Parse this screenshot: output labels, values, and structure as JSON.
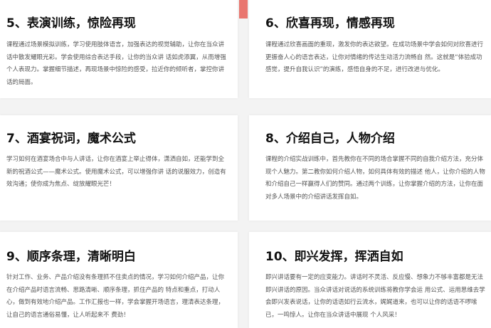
{
  "cards": [
    {
      "title": "5、表演训练，惊险再现",
      "body": "课程通过场景模拟训练，学习使用肢体语言，加强表达的视觉辅助，让你在当众讲话中散发耀眼光彩。学会使用综合表达手段，让你的当众讲 话如虎添翼，从而增强个人表现力。掌握细节描述，再现场景中惊险的感受，拉近你的倾听者，掌控你讲话的局面。"
    },
    {
      "title": "6、欣喜再现，情感再现",
      "body": "课程通过欣喜画面的重现，激发你的表达欲望。在成功场景中学会如何对欣喜进行更振奋人心的语言表达，让你对情绪的传达生动活力流畅自 然。这就是“体验成功感觉，提升自我认识”的演练，感悟自身的不足，进行改进与优化。"
    },
    {
      "title": "7、酒宴祝词，魔术公式",
      "body": "学习如何在酒宴场合中与人讲话，让你在酒宴上举止得体，潇洒自如，还能学到全新的祝酒公式——魔术公式。使用魔术公式，可以增强你讲 话的说服效力，创造有效沟通；使你成为焦点、绽放耀眼光芒！"
    },
    {
      "title": "8、介绍自己，人物介绍",
      "body": "课程的介绍实战训练中，首先教你在不同的场合掌握不同的自我介绍方法，充分体现个人魅力。第二教你如何介绍人物，如何具体有效的描述 他人，让你介绍的人物和介绍自己一样赢得人们的赞同。通过两个训练，让你掌握介绍的方法，让你在面对多人场景中的介绍讲话发挥自如。"
    },
    {
      "title": "9、顺序条理，清晰明白",
      "body": "针对工作、业务、产品介绍没有条理抓不住卖点的情况，学习如何介绍产品，让你在介绍产品时语言流畅、思路清晰、顺序条理，抓住产品的 特点和重点，打动人心，做到有效地介绍产品。工作汇报也一样，学会掌握开场语言，理清表达条理，让自己的语言通俗易懂，让人听起来不 费劲！"
    },
    {
      "title": "10、即兴发挥，挥洒自如",
      "body": "即兴讲话要有一定的应变能力。讲话时不灵活、反应慢、想象力不够丰富都是无法即兴讲话的原因。当众讲话对说话的系统训练将教你学会运 用公式、运用思维去学会即兴发表说话，让你的话语如行云流水，娓娓道来，也可以让你的话语不啰嗦已，一鸣惊人。让你在当众讲话中展现 个人风采！"
    }
  ]
}
